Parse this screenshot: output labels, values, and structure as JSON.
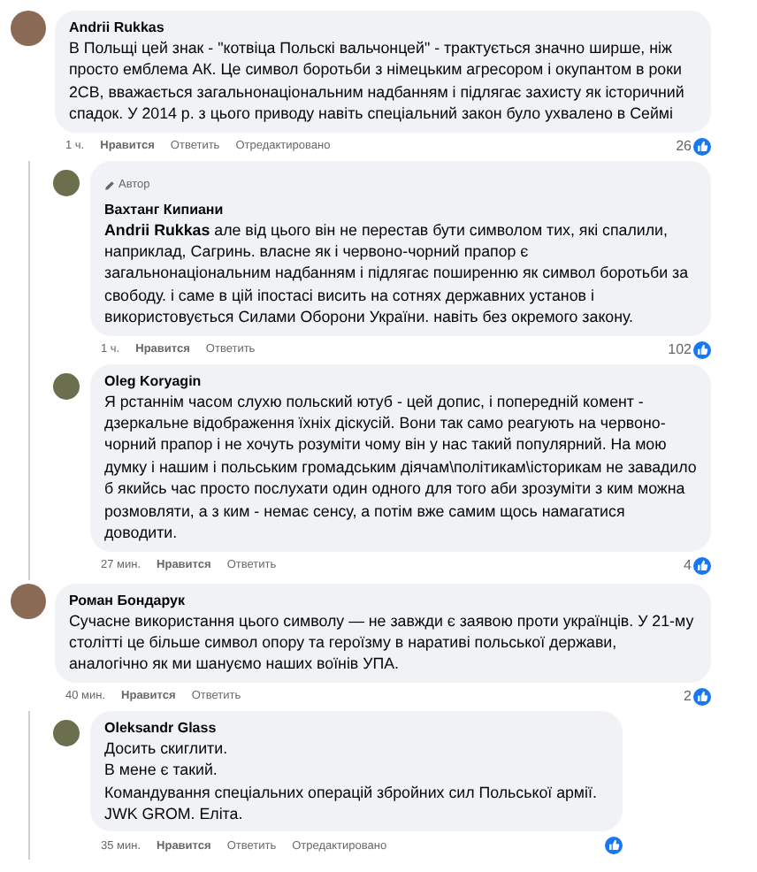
{
  "comments": [
    {
      "author": "Andrii Rukkas",
      "text": "В Польщі цей знак - \"котвіца Польскі вальчонцей\" - трактується значно ширше, ніж просто емблема АК. Це символ боротьби з німецьким агресором і окупантом в роки 2СВ, вважається загальнонаціональним надбанням і підлягає захисту як історичний спадок. У 2014 р. з цього приводу навіть спеціальний закон було ухвалено в Сеймі",
      "time": "1 ч.",
      "like": "Нравится",
      "reply": "Ответить",
      "edited": "Отредактировано",
      "reactions": "26",
      "children": [
        {
          "author": "Вахтанг Кипиани",
          "badge": "Автор",
          "text": "**Andrii Rukkas** але від цього він не перестав бути символом тих, які спалили, наприклад, Сагринь. власне як і червоно-чорний прапор є загальнонаціональним надбанням і підлягає поширенню як символ боротьби за свободу. і саме в цій іпостасі висить на сотнях державних установ і використовується Силами Оборони України. навіть без окремого закону.",
          "time": "1 ч.",
          "like": "Нравится",
          "reply": "Ответить",
          "reactions": "102"
        },
        {
          "author": "Oleg Koryagin",
          "text": "Я рстаннім часом слухю польский ютуб - цей допис, і попередній комент - дзеркальне відображення їхніх діскусій. Вони так само реагують на червоно-чорний прапор і не хочуть розуміти чому він у нас такий популярний. На мою думку і нашим і польським громадським діячам\\політикам\\історикам не завадило б якийсь час просто послухати один одного для того аби зрозуміти з ким можна розмовляти, а з ким - немає сенсу, а потім вже самим щось намагатися доводити.",
          "time": "27 мин.",
          "like": "Нравится",
          "reply": "Ответить",
          "reactions": "4"
        }
      ]
    },
    {
      "author": "Роман Бондарук",
      "text": "Сучасне використання цього символу — не завжди є заявою проти українців. У 21-му столітті це більше символ опору та героїзму в наративі польської держави, аналогічно як ми шануємо наших воїнів УПА.",
      "time": "40 мин.",
      "like": "Нравится",
      "reply": "Ответить",
      "reactions": "2",
      "children": [
        {
          "author": "Oleksandr Glass",
          "lines": [
            "Досить скиглити.",
            "В мене є такий.",
            "Командування спеціальних операцій збройних сил Польської армії.",
            "JWK GROM. Еліта."
          ],
          "time": "35 мин.",
          "like": "Нравится",
          "reply": "Ответить",
          "edited": "Отредактировано"
        }
      ]
    }
  ]
}
